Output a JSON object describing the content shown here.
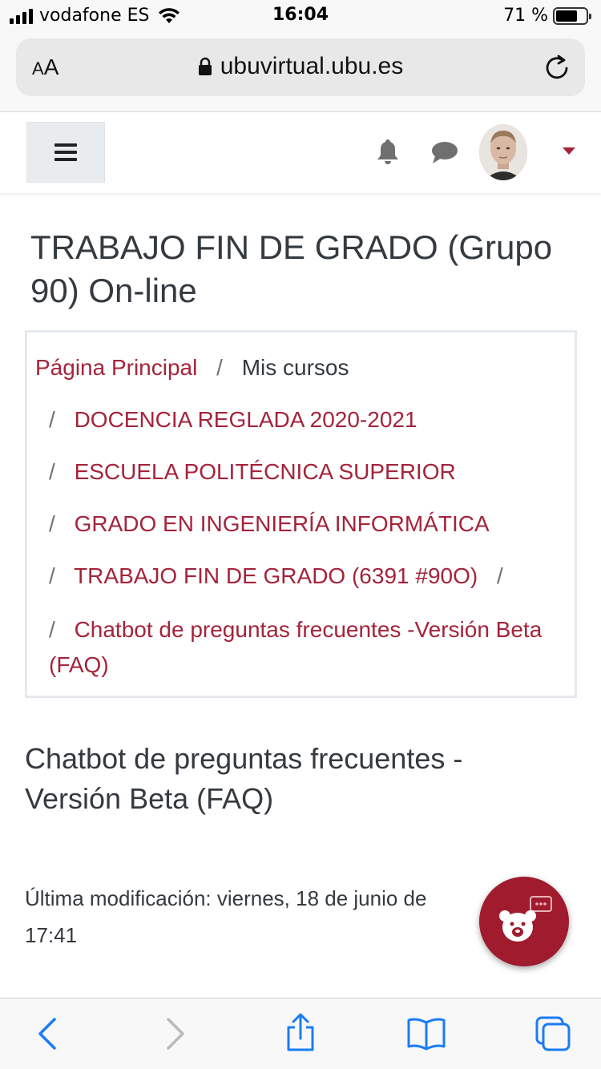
{
  "status_bar": {
    "carrier": "vodafone ES",
    "time": "16:04",
    "battery_percent": "71 %",
    "battery_level": 0.71
  },
  "browser": {
    "text_size_label_small": "A",
    "text_size_label_large": "A",
    "url": "ubuvirtual.ubu.es"
  },
  "header": {
    "accent_color": "#a4243b"
  },
  "page": {
    "title": "TRABAJO FIN DE GRADO (Grupo 90) On-line"
  },
  "breadcrumb": {
    "separator": "/",
    "items": [
      {
        "label": "Página Principal",
        "link": true
      },
      {
        "label": "Mis cursos",
        "link": false
      },
      {
        "label": "DOCENCIA REGLADA 2020-2021",
        "link": true
      },
      {
        "label": "ESCUELA POLITÉCNICA SUPERIOR",
        "link": true
      },
      {
        "label": "GRADO EN INGENIERÍA INFORMÁTICA",
        "link": true
      },
      {
        "label": "TRABAJO FIN DE GRADO (6391 #90O)",
        "link": true
      },
      {
        "label": "Chatbot de preguntas frecuentes -Versión Beta (FAQ)",
        "link": true
      }
    ]
  },
  "content": {
    "section_title": "Chatbot de preguntas frecuentes - Versión Beta (FAQ)",
    "last_modified_line1": "Última modificación: viernes, 18 de junio de",
    "last_modified_line2": "17:41"
  },
  "chatbot": {
    "color": "#a01b2e",
    "icon": "bear-chat-icon"
  },
  "toolbar": {
    "icons": [
      "back-icon",
      "forward-icon",
      "share-icon",
      "bookmarks-icon",
      "tabs-icon"
    ],
    "tint_color": "#1a7cf5"
  }
}
